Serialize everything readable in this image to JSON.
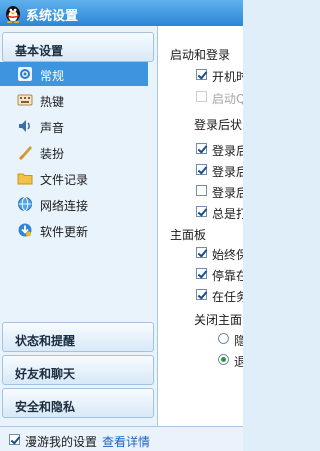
{
  "window": {
    "title": "系统设置",
    "logo_icon": "qq-penguin-icon"
  },
  "sidebar": {
    "top_category": "基本设置",
    "items": [
      {
        "label": "常规",
        "icon": "settings-icon",
        "selected": true
      },
      {
        "label": "热键",
        "icon": "keyboard-icon"
      },
      {
        "label": "声音",
        "icon": "speaker-icon"
      },
      {
        "label": "装扮",
        "icon": "paintbrush-icon"
      },
      {
        "label": "文件记录",
        "icon": "folder-icon"
      },
      {
        "label": "网络连接",
        "icon": "globe-icon"
      },
      {
        "label": "软件更新",
        "icon": "update-icon"
      }
    ],
    "bottom_categories": [
      "状态和提醒",
      "好友和聊天",
      "安全和隐私"
    ]
  },
  "content": {
    "startup_title": "启动和登录",
    "startup_options": [
      {
        "label": "开机时",
        "checked": true,
        "disabled": false
      },
      {
        "label": "启动Q",
        "checked": false,
        "disabled": true
      }
    ],
    "after_login_title": "登录后状",
    "after_login_options": [
      {
        "label": "登录后",
        "checked": true
      },
      {
        "label": "登录后",
        "checked": true
      },
      {
        "label": "登录后",
        "checked": false
      },
      {
        "label": "总是打",
        "checked": true
      }
    ],
    "main_panel_title": "主面板",
    "main_panel_options": [
      {
        "label": "始终保",
        "checked": true
      },
      {
        "label": "停靠在",
        "checked": true
      },
      {
        "label": "在任务",
        "checked": true
      }
    ],
    "close_panel_title": "关闭主面",
    "close_options": [
      {
        "label": "隐",
        "selected": false
      },
      {
        "label": "退",
        "selected": true
      }
    ]
  },
  "footer": {
    "roam_label": "漫游我的设置",
    "roam_checked": true,
    "details_link": "查看详情"
  },
  "colors": {
    "title_bar": "#3f9be3",
    "selected_item": "#3d95e0",
    "link": "#1b64c0"
  }
}
